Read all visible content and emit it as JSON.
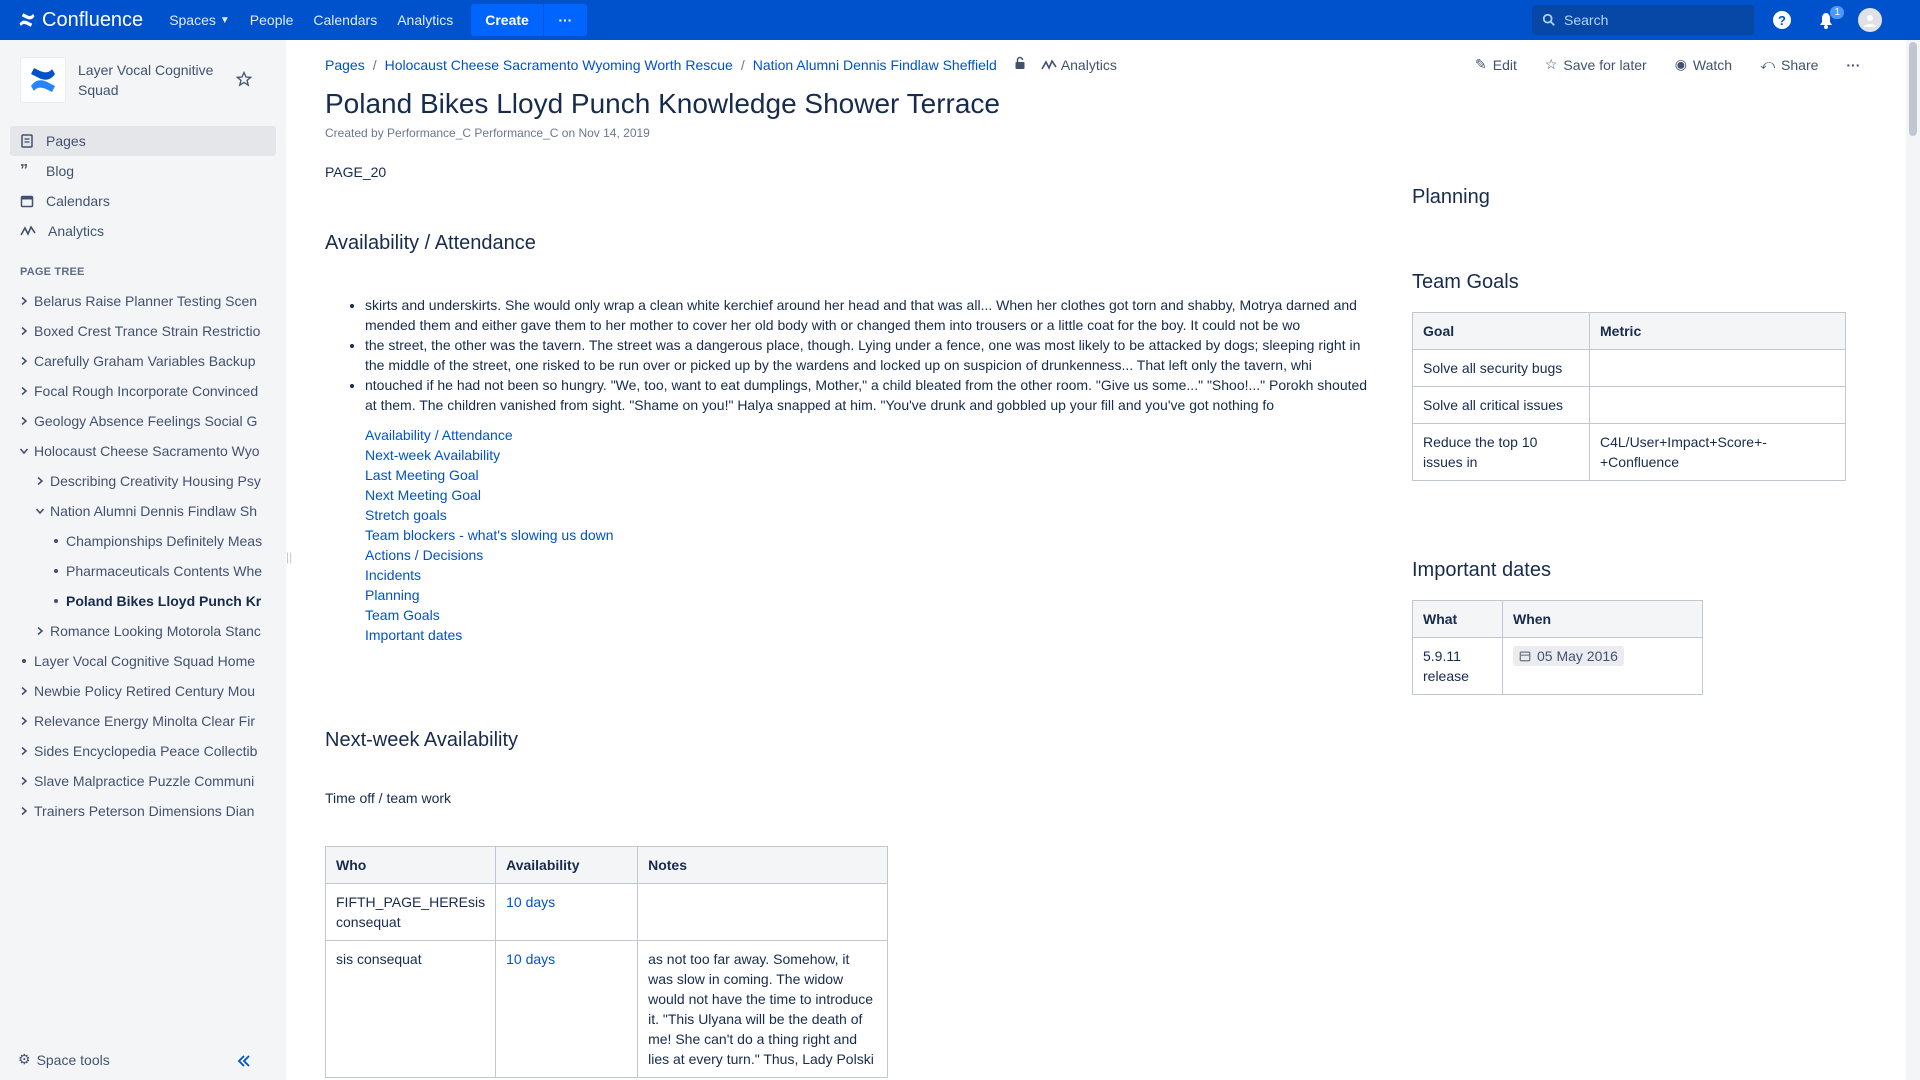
{
  "topbar": {
    "logo_text": "Confluence",
    "nav": [
      "Spaces",
      "People",
      "Calendars",
      "Analytics"
    ],
    "create_label": "Create",
    "more_label": "···",
    "search_placeholder": "Search",
    "notification_count": "1",
    "brand_color": "#0052cc"
  },
  "sidebar": {
    "space_name": "Layer Vocal Cognitive Squad",
    "nav": [
      {
        "label": "Pages",
        "icon": "pages-icon"
      },
      {
        "label": "Blog",
        "icon": "quote-icon"
      },
      {
        "label": "Calendars",
        "icon": "calendar-icon"
      },
      {
        "label": "Analytics",
        "icon": "analytics-icon"
      }
    ],
    "page_tree_label": "PAGE TREE",
    "tree": [
      {
        "label": "Belarus Raise Planner Testing Scen",
        "level": 0,
        "chev": "right"
      },
      {
        "label": "Boxed Crest Trance Strain Restrictio",
        "level": 0,
        "chev": "right"
      },
      {
        "label": "Carefully Graham Variables Backup",
        "level": 0,
        "chev": "right"
      },
      {
        "label": "Focal Rough Incorporate Convinced",
        "level": 0,
        "chev": "right"
      },
      {
        "label": "Geology Absence Feelings Social G",
        "level": 0,
        "chev": "right"
      },
      {
        "label": "Holocaust Cheese Sacramento Wyo",
        "level": 0,
        "chev": "down"
      },
      {
        "label": "Describing Creativity Housing Psy",
        "level": 1,
        "chev": "right"
      },
      {
        "label": "Nation Alumni Dennis Findlaw Sh",
        "level": 1,
        "chev": "down"
      },
      {
        "label": "Championships Definitely Meas",
        "level": 2,
        "chev": "dot"
      },
      {
        "label": "Pharmaceuticals Contents Whe",
        "level": 2,
        "chev": "dot"
      },
      {
        "label": "Poland Bikes Lloyd Punch Kr",
        "level": 2,
        "chev": "dot",
        "current": true
      },
      {
        "label": "Romance Looking Motorola Stanc",
        "level": 1,
        "chev": "right"
      },
      {
        "label": "Layer Vocal Cognitive Squad Home",
        "level": 0,
        "chev": "dot"
      },
      {
        "label": "Newbie Policy Retired Century Mou",
        "level": 0,
        "chev": "right"
      },
      {
        "label": "Relevance Energy Minolta Clear Fir",
        "level": 0,
        "chev": "right"
      },
      {
        "label": "Sides Encyclopedia Peace Collectib",
        "level": 0,
        "chev": "right"
      },
      {
        "label": "Slave Malpractice Puzzle Communi",
        "level": 0,
        "chev": "right"
      },
      {
        "label": "Trainers Peterson Dimensions Dian",
        "level": 0,
        "chev": "right"
      }
    ],
    "space_tools": "Space tools"
  },
  "breadcrumbs": [
    "Pages",
    "Holocaust Cheese Sacramento Wyoming Worth Rescue",
    "Nation Alumni Dennis Findlaw Sheffield"
  ],
  "breadcrumb_analytics": "Analytics",
  "actions": {
    "edit": "Edit",
    "save": "Save for later",
    "watch": "Watch",
    "share": "Share"
  },
  "page": {
    "title": "Poland Bikes Lloyd Punch Knowledge Shower Terrace",
    "byline": "Created by Performance_C Performance_C on Nov 14, 2019",
    "tag": "PAGE_20",
    "h_availability": "Availability / Attendance",
    "bullets": [
      "skirts and underskirts. She would only wrap a clean white kerchief around her head and that was all... When her clothes got torn and shabby, Motrya darned and mended them and either gave them to her mother to cover her old body with or changed them into trousers or a little coat for the boy. It could not be wo",
      "the street, the other was the tavern. The street was a dangerous place, though. Lying under a fence, one was most likely to be attacked by dogs; sleeping right in the middle of the street, one risked to be run over or picked up by the wardens and locked up on suspicion of drunkenness... That left only the tavern, whi",
      "ntouched if he had not been so hungry. \"We, too, want to eat dumplings, Mother,\" a child bleated from the other room. \"Give us some...\" \"Shoo!...\" Porokh shouted at them. The children vanished from sight. \"Shame on you!\" Halya snapped at him. \"You've drunk and gobbled up your fill and you've got nothing fo"
    ],
    "toc": [
      "Availability / Attendance",
      "Next-week Availability",
      "Last Meeting Goal",
      "Next Meeting Goal",
      "Stretch goals",
      "Team blockers - what's slowing us down",
      "Actions / Decisions",
      "Incidents",
      "Planning",
      "Team Goals",
      "Important dates"
    ],
    "h_next_week": "Next-week Availability",
    "time_off": "Time off / team work",
    "availability_table": {
      "headers": [
        "Who",
        "Availability",
        "Notes"
      ],
      "rows": [
        [
          "FIFTH_PAGE_HEREsis consequat",
          "10 days",
          ""
        ],
        [
          "sis consequat",
          "10 days",
          "as not too far away. Somehow, it was slow in coming. The widow would not have the time to introduce it. \"This Ulyana will be the death of me! She can't do a thing right and lies at every turn.\" Thus, Lady Polski"
        ]
      ]
    },
    "h_planning": "Planning",
    "h_team_goals": "Team Goals",
    "goals_table": {
      "headers": [
        "Goal",
        "Metric"
      ],
      "rows": [
        [
          "Solve all security bugs",
          ""
        ],
        [
          "Solve all critical issues",
          ""
        ],
        [
          "Reduce the top 10 issues in",
          "C4L/User+Impact+Score+-+Confluence"
        ]
      ]
    },
    "h_important_dates": "Important dates",
    "dates_table": {
      "headers": [
        "What",
        "When"
      ],
      "rows": [
        [
          "5.9.11 release",
          "05 May 2016"
        ]
      ]
    }
  }
}
